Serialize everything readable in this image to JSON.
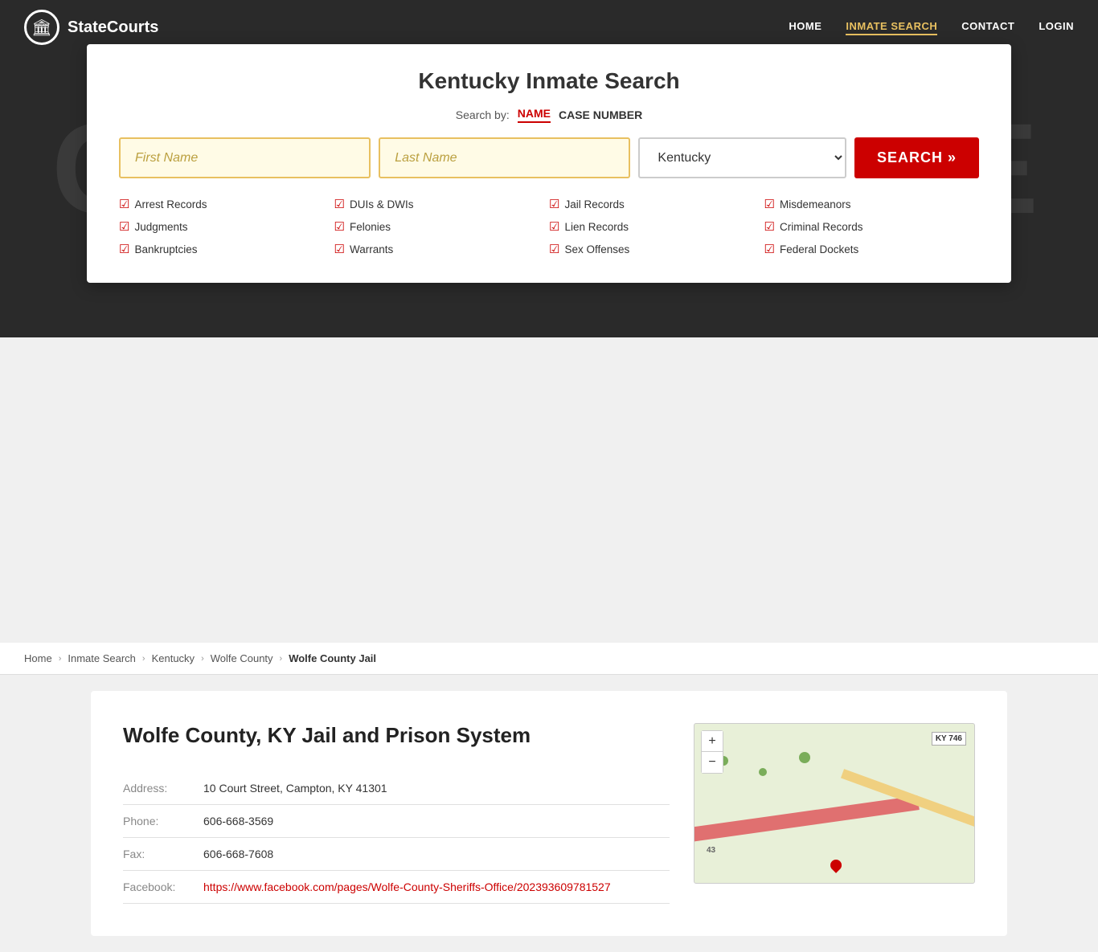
{
  "site": {
    "logo_text": "StateCourts",
    "logo_icon": "🏛"
  },
  "nav": {
    "links": [
      {
        "label": "HOME",
        "active": false
      },
      {
        "label": "INMATE SEARCH",
        "active": true
      },
      {
        "label": "CONTACT",
        "active": false
      },
      {
        "label": "LOGIN",
        "active": false
      }
    ]
  },
  "hero": {
    "bg_text": "COURTHOUSE"
  },
  "search_modal": {
    "title": "Kentucky Inmate Search",
    "search_by_label": "Search by:",
    "tab_name": "NAME",
    "tab_case": "CASE NUMBER",
    "first_name_placeholder": "First Name",
    "last_name_placeholder": "Last Name",
    "state_value": "Kentucky",
    "search_button": "SEARCH »",
    "features": [
      "Arrest Records",
      "DUIs & DWIs",
      "Jail Records",
      "Misdemeanors",
      "Judgments",
      "Felonies",
      "Lien Records",
      "Criminal Records",
      "Bankruptcies",
      "Warrants",
      "Sex Offenses",
      "Federal Dockets"
    ]
  },
  "breadcrumb": {
    "items": [
      {
        "label": "Home",
        "link": true
      },
      {
        "label": "Inmate Search",
        "link": true
      },
      {
        "label": "Kentucky",
        "link": true
      },
      {
        "label": "Wolfe County",
        "link": true
      },
      {
        "label": "Wolfe County Jail",
        "link": false
      }
    ]
  },
  "facility": {
    "title": "Wolfe County, KY Jail and Prison System",
    "fields": [
      {
        "label": "Address:",
        "value": "10 Court Street, Campton, KY 41301",
        "link": false
      },
      {
        "label": "Phone:",
        "value": "606-668-3569",
        "link": false
      },
      {
        "label": "Fax:",
        "value": "606-668-7608",
        "link": false
      },
      {
        "label": "Facebook:",
        "value": "https://www.facebook.com/pages/Wolfe-County-Sheriffs-Office/202393609781527",
        "link": true,
        "display": "https://www.facebook.com/pages/Wolfe-County-Sheriffs-Office/202393609781527"
      }
    ]
  },
  "map": {
    "zoom_in": "+",
    "zoom_out": "−",
    "label_ky746": "KY 746",
    "label_43": "43"
  }
}
